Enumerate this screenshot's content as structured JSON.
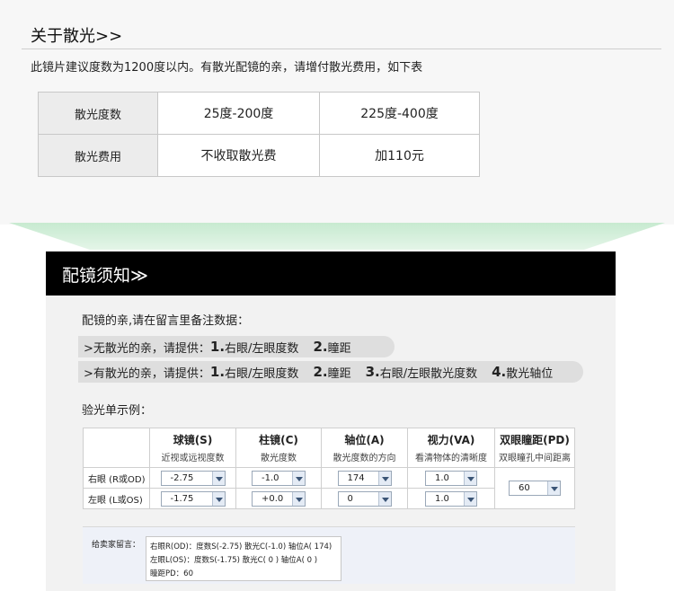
{
  "astigmatism": {
    "title": "关于散光>>",
    "note": "此镜片建议度数为1200度以内。有散光配镜的亲，请增付散光费用，如下表",
    "table": {
      "row1_header": "散光度数",
      "row1": [
        "25度-200度",
        "225度-400度"
      ],
      "row2_header": "散光费用",
      "row2": [
        "不收取散光费",
        "加110元"
      ]
    }
  },
  "notice": {
    "title": "配镜须知≫",
    "intro": "配镜的亲,请在留言里备注数据：",
    "no_astig": {
      "prefix": ">无散光的亲，请提供：",
      "n1": "1.",
      "t1": "右眼/左眼度数",
      "n2": "2.",
      "t2": "瞳距"
    },
    "with_astig": {
      "prefix": ">有散光的亲，请提供：",
      "n1": "1.",
      "t1": "右眼/左眼度数",
      "n2": "2.",
      "t2": "瞳距",
      "n3": "3.",
      "t3": "右眼/左眼散光度数",
      "n4": "4.",
      "t4": "散光轴位"
    },
    "sample_label": "验光单示例："
  },
  "prescription": {
    "headers": [
      {
        "main": "球镜(S)",
        "sub": "近视或远视度数"
      },
      {
        "main": "柱镜(C)",
        "sub": "散光度数"
      },
      {
        "main": "轴位(A)",
        "sub": "散光度数的方向"
      },
      {
        "main": "视力(VA)",
        "sub": "看清物体的清晰度"
      },
      {
        "main": "双眼瞳距(PD)",
        "sub": "双眼瞳孔中间距离"
      }
    ],
    "right_eye": {
      "label": "右眼 (R或OD)",
      "sphere": "-2.75",
      "cylinder": "-1.0",
      "axis": "174",
      "va": "1.0"
    },
    "left_eye": {
      "label": "左眼 (L或OS)",
      "sphere": "-1.75",
      "cylinder": "+0.0",
      "axis": "0",
      "va": "1.0"
    },
    "pd": "60"
  },
  "message": {
    "label": "给卖家留言：",
    "lines": [
      "右眼R(OD)：度数S(-2.75)   散光C(-1.0)   轴位A( 174)",
      "左眼L(OS)：度数S(-1.75)   散光C( 0 )    轴位A( 0 )",
      "瞳距PD：60"
    ]
  },
  "colors": {
    "header_black": "#000000",
    "funnel_green": "#b6e3bd",
    "pill_gray": "#dedede",
    "select_arrow": "#3b5576"
  }
}
